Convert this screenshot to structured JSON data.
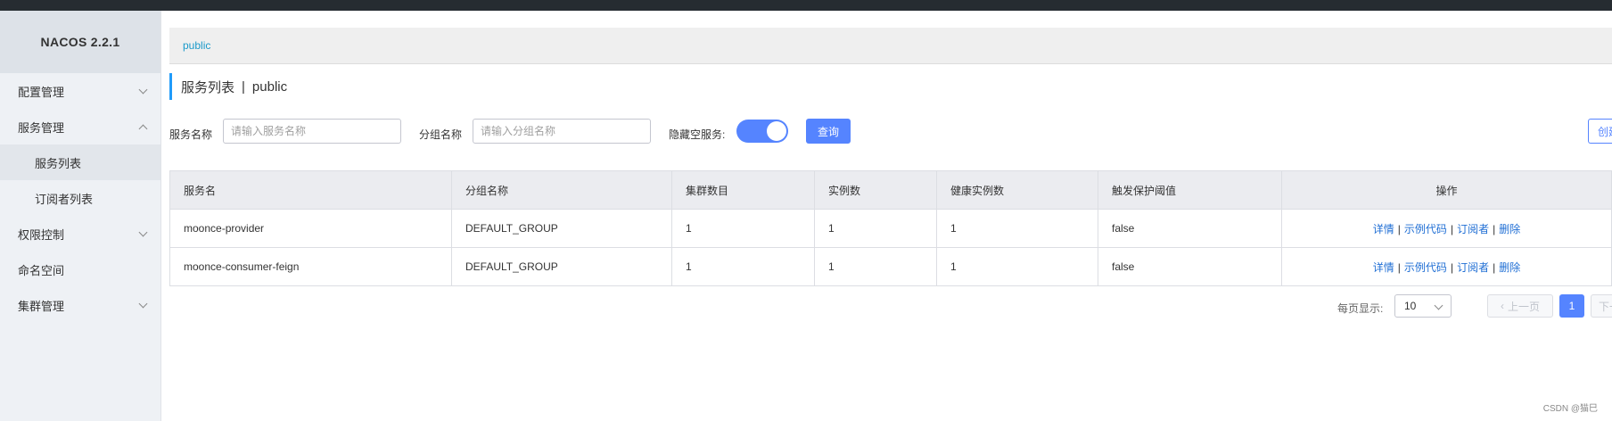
{
  "sidebar": {
    "logo": "NACOS 2.2.1",
    "items": [
      {
        "label": "配置管理"
      },
      {
        "label": "服务管理"
      },
      {
        "label": "服务列表"
      },
      {
        "label": "订阅者列表"
      },
      {
        "label": "权限控制"
      },
      {
        "label": "命名空间"
      },
      {
        "label": "集群管理"
      }
    ]
  },
  "namespace_bar": {
    "current": "public"
  },
  "page_title": {
    "main": "服务列表",
    "separator": "|",
    "namespace": "public"
  },
  "filters": {
    "service_name_label": "服务名称",
    "service_name_placeholder": "请输入服务名称",
    "group_name_label": "分组名称",
    "group_name_placeholder": "请输入分组名称",
    "hide_empty_label": "隐藏空服务:",
    "hide_empty_on": true,
    "query_button": "查询",
    "create_button": "创建服务"
  },
  "table": {
    "headers": [
      "服务名",
      "分组名称",
      "集群数目",
      "实例数",
      "健康实例数",
      "触发保护阈值",
      "操作"
    ],
    "rows": [
      {
        "service": "moonce-provider",
        "group": "DEFAULT_GROUP",
        "clusters": "1",
        "instances": "1",
        "healthy": "1",
        "protect": "false"
      },
      {
        "service": "moonce-consumer-feign",
        "group": "DEFAULT_GROUP",
        "clusters": "1",
        "instances": "1",
        "healthy": "1",
        "protect": "false"
      }
    ],
    "actions": {
      "detail": "详情",
      "sample_code": "示例代码",
      "subscribers": "订阅者",
      "delete": "删除",
      "separator": "|"
    }
  },
  "pagination": {
    "page_size_label": "每页显示:",
    "page_size": "10",
    "prev": "上一页",
    "current_page": "1",
    "next": "下一页"
  },
  "watermark": "CSDN @猫巳",
  "colors": {
    "accent": "#5584ff",
    "link": "#1f6ed4",
    "namespace_link": "#1b9ac9"
  }
}
